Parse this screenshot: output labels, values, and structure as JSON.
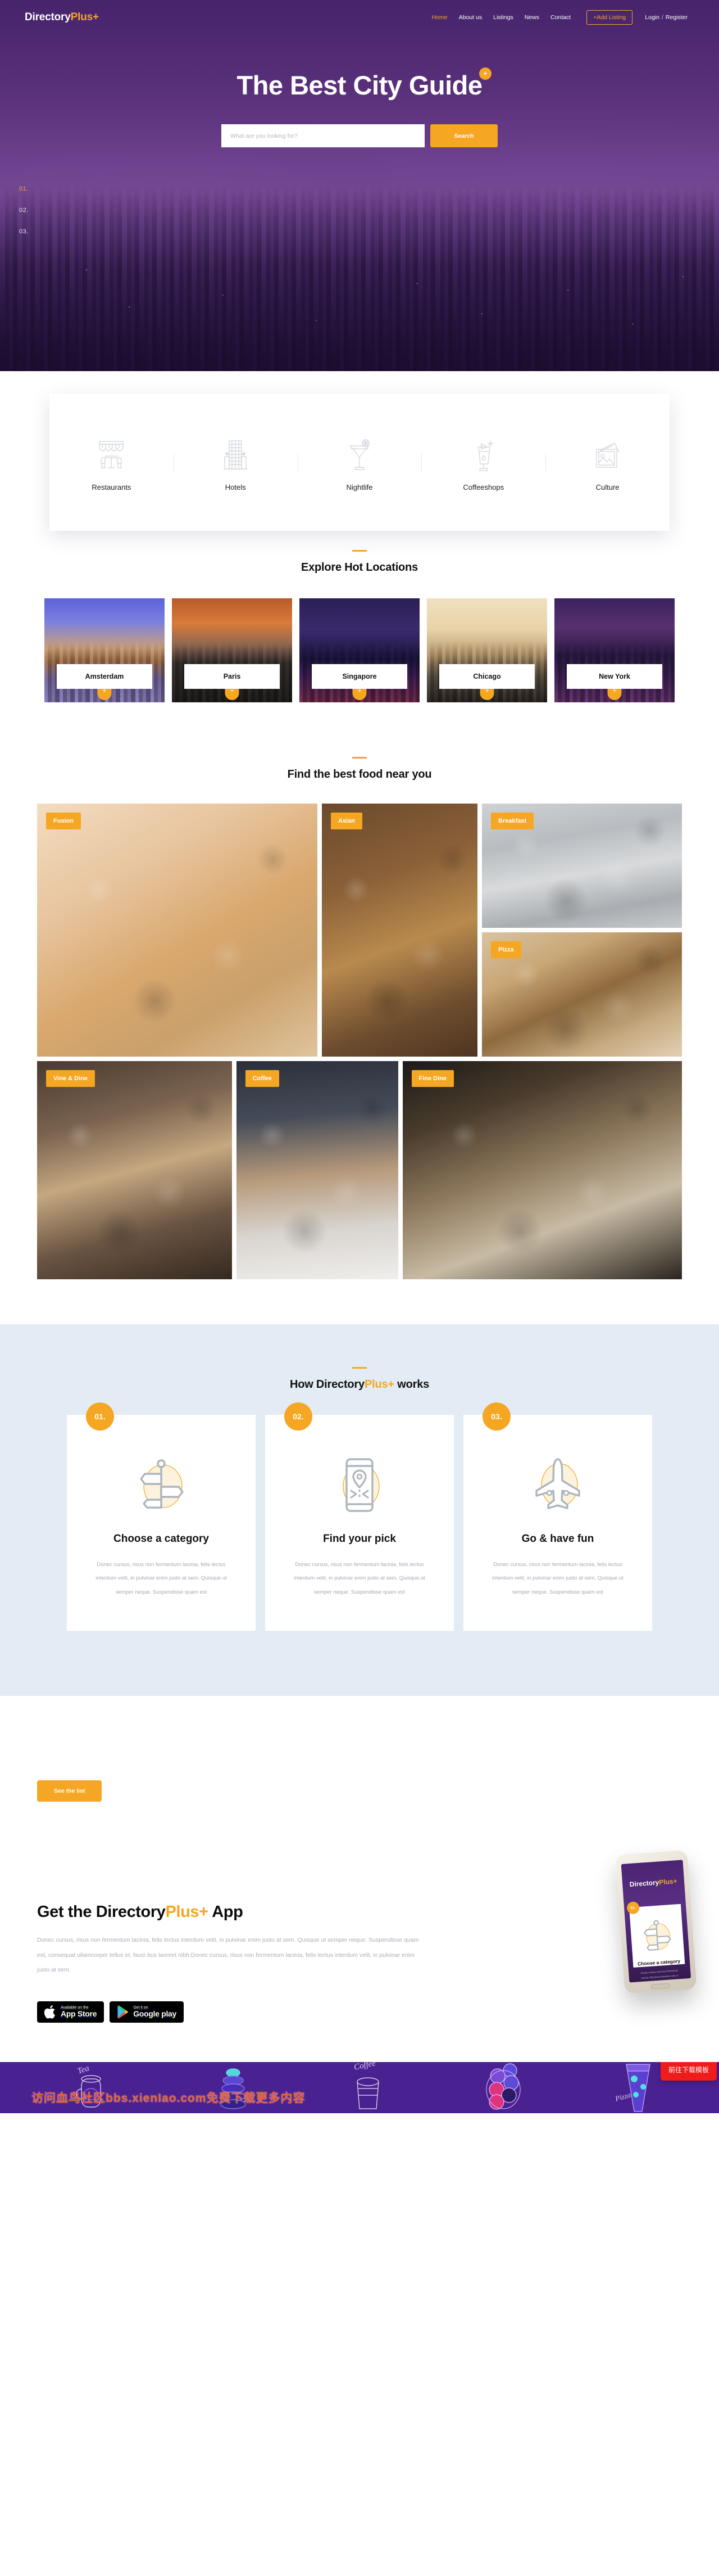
{
  "brand": {
    "name_a": "Directory",
    "name_b": "Plus",
    "plus": "+"
  },
  "nav": {
    "items": [
      {
        "label": "Home",
        "active": true
      },
      {
        "label": "About us",
        "active": false
      },
      {
        "label": "Listings",
        "active": false
      },
      {
        "label": "News",
        "active": false
      },
      {
        "label": "Contact",
        "active": false
      }
    ],
    "add_listing": "+Add Listing",
    "login": "Login",
    "separator": "/",
    "register": "Register"
  },
  "hero": {
    "title": "The Best City Guide",
    "badge": "+",
    "search_placeholder": "What are you looking for?",
    "search_value": "",
    "search_button": "Search",
    "slide_numbers": [
      "01.",
      "02.",
      "03."
    ],
    "active_slide": "01."
  },
  "categories": [
    {
      "label": "Restaurants",
      "icon": "restaurant-awning-icon"
    },
    {
      "label": "Hotels",
      "icon": "hotel-building-icon"
    },
    {
      "label": "Nightlife",
      "icon": "cocktail-glass-icon"
    },
    {
      "label": "Coffeeshops",
      "icon": "juice-glass-icon"
    },
    {
      "label": "Culture",
      "icon": "picture-frame-icon"
    }
  ],
  "locations": {
    "title": "Explore Hot Locations",
    "items": [
      {
        "name": "Amsterdam",
        "art": "city-ams"
      },
      {
        "name": "Paris",
        "art": "city-par"
      },
      {
        "name": "Singapore",
        "art": "city-sin"
      },
      {
        "name": "Chicago",
        "art": "city-chi"
      },
      {
        "name": "New York",
        "art": "city-nyc"
      }
    ],
    "plus_badge": "+"
  },
  "food": {
    "title": "Find the best food near you",
    "row1": [
      {
        "tag": "Fusion",
        "art": "f-fusion"
      },
      {
        "tag": "Asian",
        "art": "f-asian"
      },
      {
        "tag": "Breakfast",
        "art": "f-break"
      },
      {
        "tag": "Pizza",
        "art": "f-pizza"
      }
    ],
    "row2": [
      {
        "tag": "Vine & Dine",
        "art": "f-vine"
      },
      {
        "tag": "Coffee",
        "art": "f-coffee"
      },
      {
        "tag": "Fine Dine",
        "art": "f-fine"
      }
    ]
  },
  "works": {
    "title_a": "How Directory",
    "title_b": "Plus+",
    "title_c": " works",
    "cards": [
      {
        "num": "01.",
        "title": "Choose a category",
        "desc": "Donec cursus, risus non fermentum lacinia, felis lectus interdum velit, in pulvinar enim justo at sem. Quisque ut semper neque. Suspendisse quam est",
        "icon": "signpost-icon"
      },
      {
        "num": "02.",
        "title": "Find your pick",
        "desc": "Donec cursus, risus non fermentum lacinia, felis lectus interdum velit, in pulvinar enim justo at sem. Quisque ut semper neque. Suspendisse quam est",
        "icon": "map-pin-phone-icon"
      },
      {
        "num": "03.",
        "title": "Go & have fun",
        "desc": "Donec cursus, risus non fermentum lacinia, felis lectus interdum velit, in pulvinar enim justo at sem. Quisque ut semper neque. Suspendisse quam est",
        "icon": "airplane-icon"
      }
    ]
  },
  "cta": {
    "lead": "",
    "button": "See the list"
  },
  "app": {
    "title_a": "Get the Directory",
    "title_b": "Plus+",
    "title_c": " App",
    "desc": "Donec cursus, risus non fermentum lacinia, felis lectus interdum velit, in pulvinar enim justo at sem. Quisque ut semper neque. Suspendisse quam est, consequat ullamcorper tellus et, fauci bus laoreet nibh.Donec cursus, risus non fermentum lacinia, felis lectus interdum velit, in pulvinar enim justo at sem.",
    "appstore": {
      "line1": "Available on the",
      "line2": "App Store"
    },
    "googleplay": {
      "line1": "Get it on",
      "line2": "Google play"
    },
    "phone": {
      "brand_a": "Directory",
      "brand_b": "Plus+",
      "card_num": "01.",
      "card_title": "Choose a category",
      "card_desc": "Donec cursus, risus non fermentum lacinia, felis lectus interdum velit, in pulvinar enim justo at sem. Quisque ut semper neque. Suspendisse quam est"
    }
  },
  "footer_strip": {
    "illustrations": [
      "Tea",
      "Coffee"
    ],
    "watermark": "访问血鸟社区bbs.xienIao.com免费下载更多内容",
    "download_button": "前往下载模板"
  },
  "colors": {
    "accent": "#f5a623",
    "purple": "#4a2570",
    "footer_purple": "#4a2191",
    "works_bg": "#e3ecf5",
    "red": "#f01c1c",
    "watermark": "#e8603c"
  }
}
